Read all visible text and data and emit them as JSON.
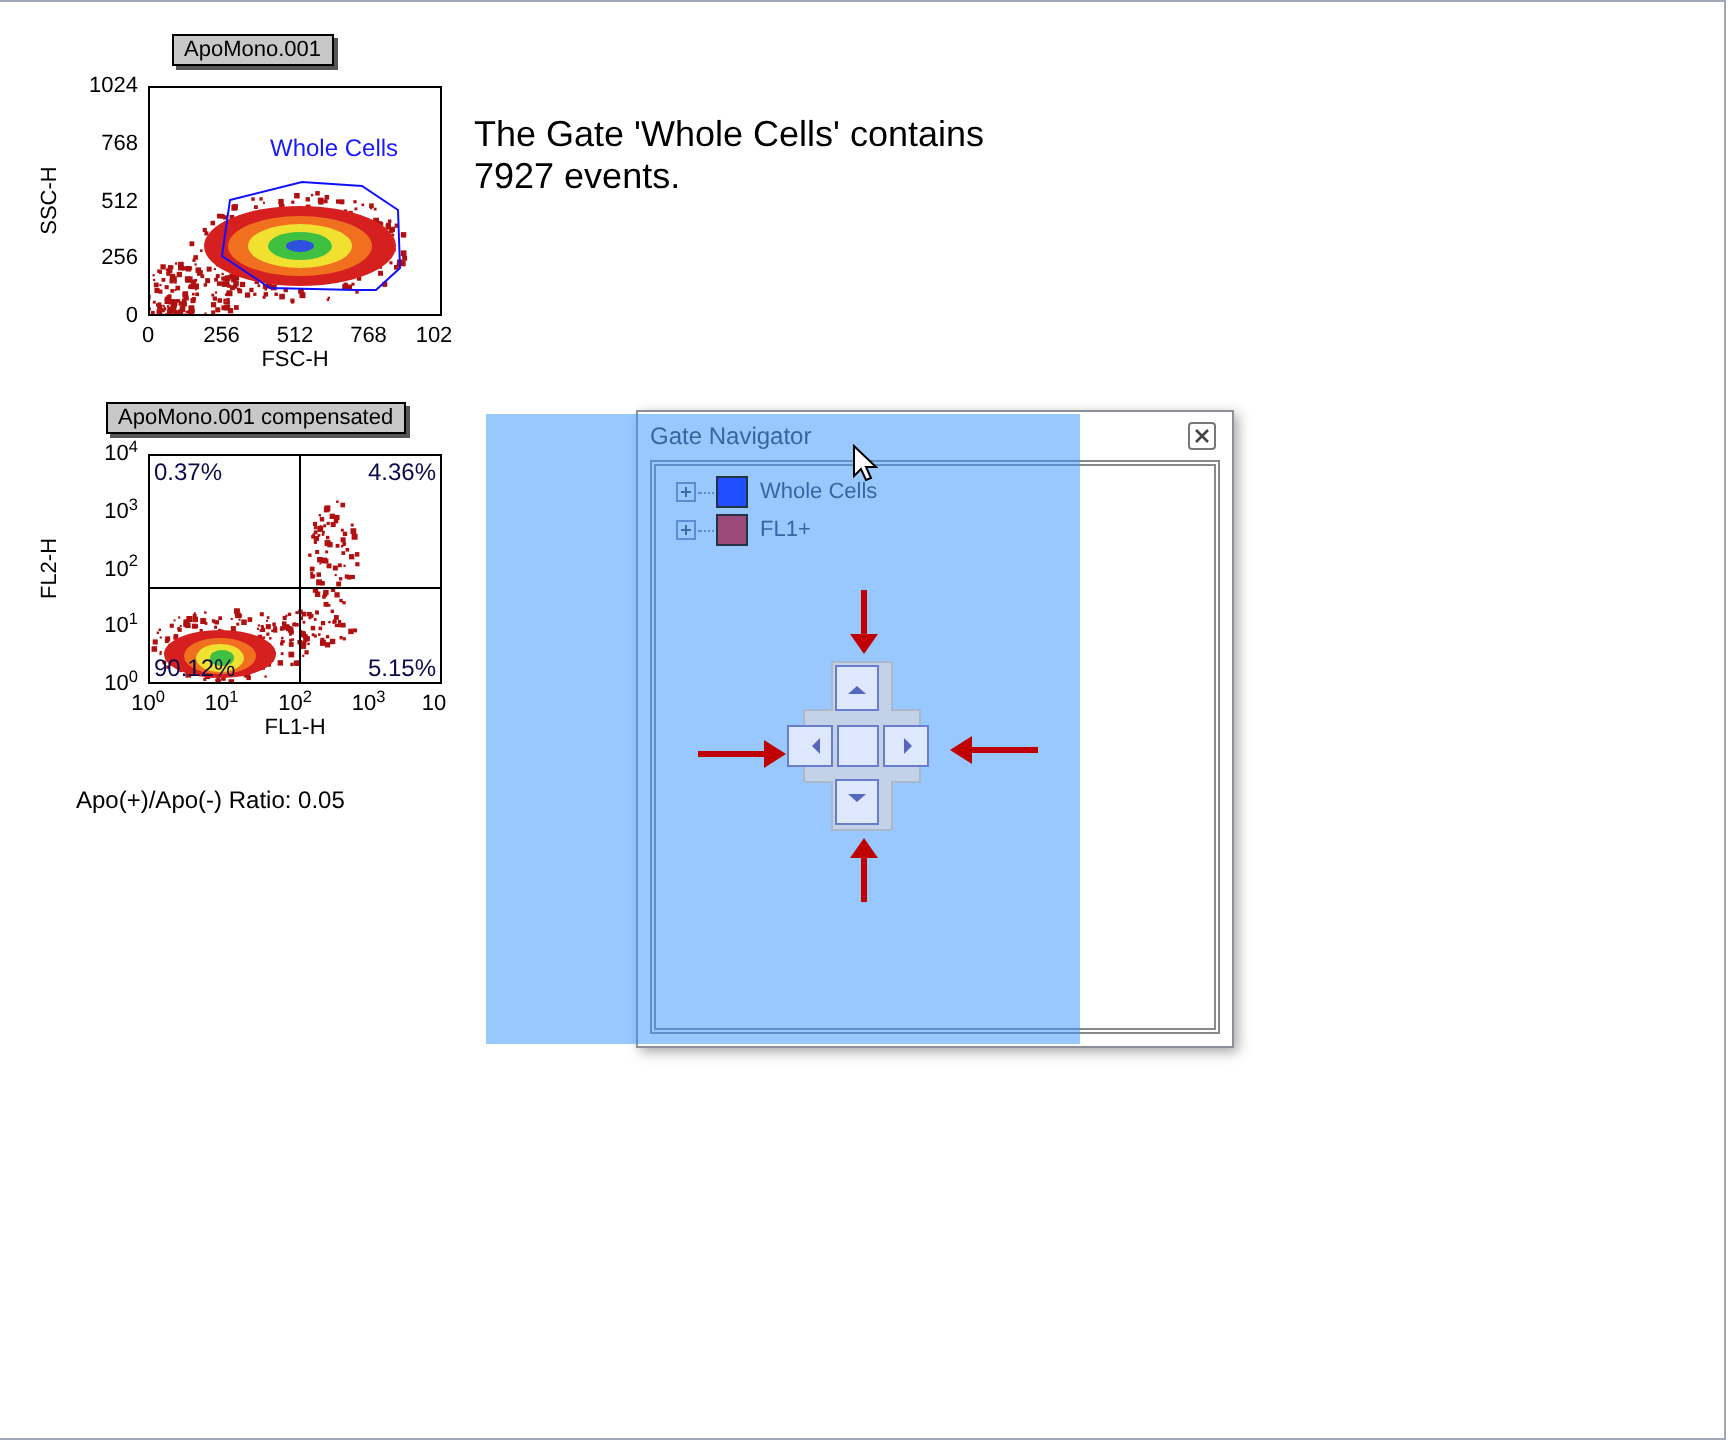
{
  "plots": [
    {
      "kind": "gated",
      "title": "ApoMono.001",
      "ylabel": "SSC-H",
      "xlabel": "FSC-H",
      "yticks": [
        "1024",
        "768",
        "512",
        "256",
        "0"
      ],
      "xticks": [
        "0",
        "256",
        "512",
        "768",
        "102"
      ],
      "gate_label": "Whole Cells"
    },
    {
      "kind": "quadrant",
      "title": "ApoMono.001 compensated",
      "ylabel": "FL2-H",
      "xlabel": "FL1-H",
      "yticks": [
        "10$^{4}$",
        "10$^{3}$",
        "10$^{2}$",
        "10$^{1}$",
        "10$^{0}$"
      ],
      "xticks": [
        "10$^{0}$",
        "10$^{1}$",
        "10$^{2}$",
        "10$^{3}$",
        "10"
      ],
      "quadrants": [
        "0.37%",
        "4.36%",
        "90.12%",
        "5.15%"
      ],
      "caption": "Apo(+)/Apo(-) Ratio: 0.05"
    }
  ],
  "gate_message": "The Gate 'Whole Cells' contains 7927 events.",
  "gate_navigator": {
    "title": "Gate Navigator",
    "gates": [
      {
        "label": "Whole Cells",
        "color": "#1f4fff"
      },
      {
        "label": "FL1+",
        "color": "#9b4a7a"
      }
    ]
  }
}
